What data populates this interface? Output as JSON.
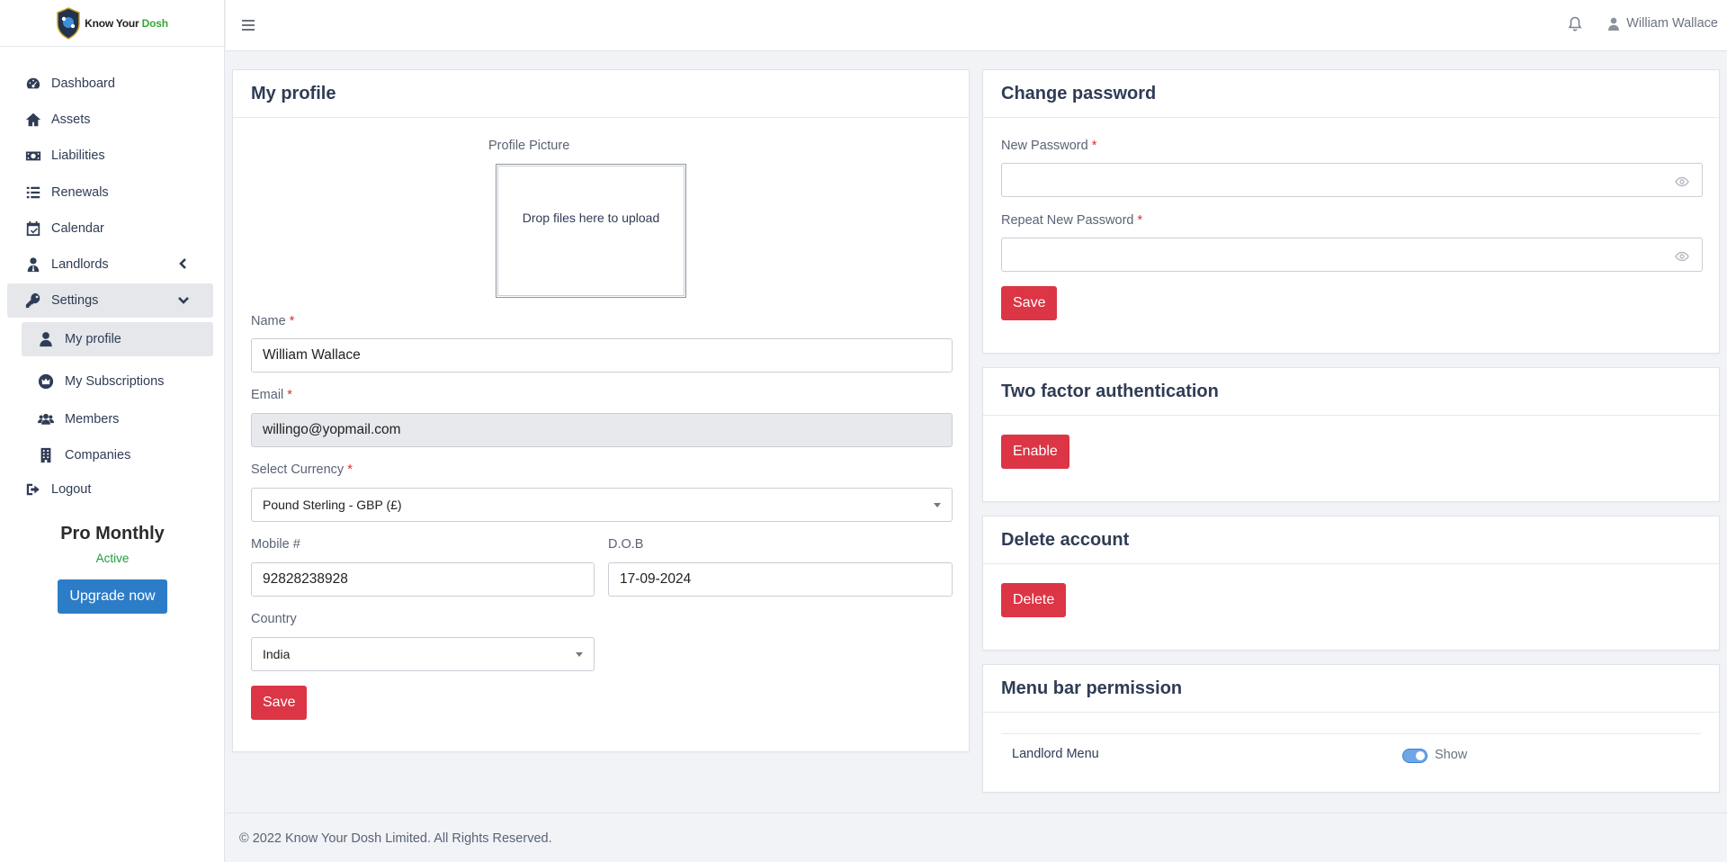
{
  "app": {
    "logo_text_main": "Know Your ",
    "logo_text_accent": "Dosh"
  },
  "sidebar": {
    "items": [
      {
        "label": "Dashboard",
        "icon": "speedometer-icon"
      },
      {
        "label": "Assets",
        "icon": "home-icon"
      },
      {
        "label": "Liabilities",
        "icon": "money-bill-icon"
      },
      {
        "label": "Renewals",
        "icon": "list-icon"
      },
      {
        "label": "Calendar",
        "icon": "calendar-check-icon"
      },
      {
        "label": "Landlords",
        "icon": "user-tie-icon"
      },
      {
        "label": "Settings",
        "icon": "key-icon"
      },
      {
        "label": "Logout",
        "icon": "sign-out-icon"
      }
    ],
    "settings_sub": [
      {
        "label": "My profile",
        "icon": "user-icon"
      },
      {
        "label": "My Subscriptions",
        "icon": "crown-icon"
      },
      {
        "label": "Members",
        "icon": "users-icon"
      },
      {
        "label": "Companies",
        "icon": "building-icon"
      }
    ],
    "plan": {
      "name": "Pro Monthly",
      "status": "Active",
      "upgrade_label": "Upgrade now"
    }
  },
  "topbar": {
    "user_name": "William Wallace"
  },
  "profile": {
    "title": "My profile",
    "picture_label": "Profile Picture",
    "dropzone_text": "Drop files here to upload",
    "name_label": "Name",
    "name_value": "William Wallace",
    "email_label": "Email",
    "email_value": "willingo@yopmail.com",
    "currency_label": "Select Currency",
    "currency_value": "Pound Sterling - GBP (£)",
    "mobile_label": "Mobile #",
    "mobile_value": "92828238928",
    "dob_label": "D.O.B",
    "dob_value": "17-09-2024",
    "country_label": "Country",
    "country_value": "India",
    "save_label": "Save",
    "required_mark": "*"
  },
  "password": {
    "title": "Change password",
    "new_label": "New Password",
    "repeat_label": "Repeat New Password",
    "save_label": "Save"
  },
  "twofa": {
    "title": "Two factor authentication",
    "enable_label": "Enable"
  },
  "delete_account": {
    "title": "Delete account",
    "delete_label": "Delete"
  },
  "menu_permission": {
    "title": "Menu bar permission",
    "row_label": "Landlord Menu",
    "toggle_text": "Show",
    "toggle_on": true
  },
  "footer": {
    "text": "© 2022 Know Your Dosh Limited. All Rights Reserved."
  },
  "colors": {
    "accent_red": "#dc3545",
    "accent_blue": "#2d7cc7",
    "status_green": "#1f9d3a"
  }
}
